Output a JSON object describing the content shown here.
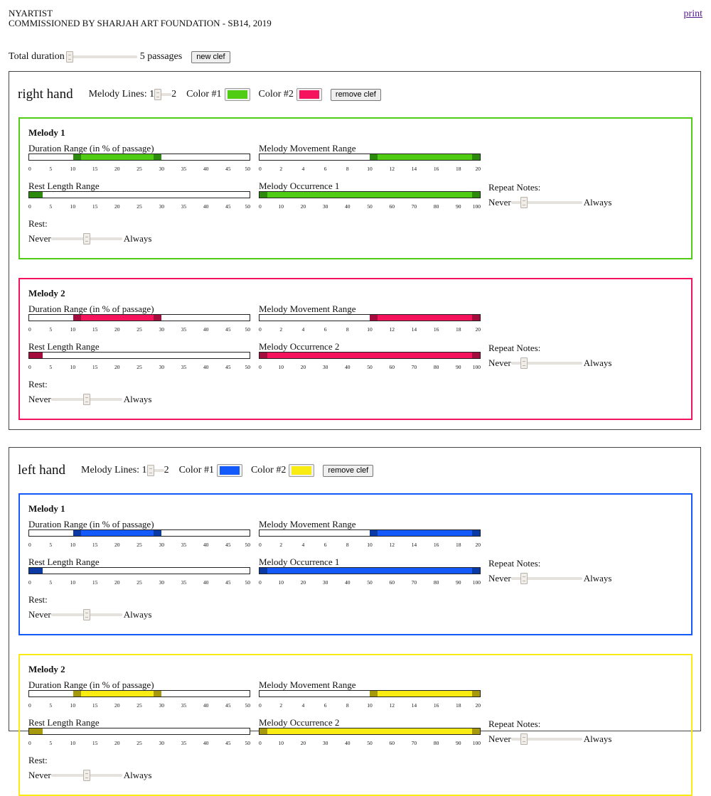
{
  "header": {
    "title": "NYARTIST",
    "subtitle": "COMMISSIONED BY SHARJAH ART FOUNDATION - SB14, 2019",
    "print_link": "print"
  },
  "toolbar": {
    "total_duration_label": "Total duration",
    "total_duration_value": 0,
    "passages_text": "5 passages",
    "new_clef_label": "new clef"
  },
  "labels": {
    "melody_lines": "Melody Lines: 1",
    "melody_lines_max": "2",
    "color1": "Color #1",
    "color2": "Color #2",
    "remove_clef": "remove clef",
    "duration_range": "Duration Range (in % of passage)",
    "movement_range": "Melody Movement Range",
    "rest_length_range": "Rest Length Range",
    "repeat_notes": "Repeat Notes:",
    "rest": "Rest:",
    "never": "Never",
    "always": "Always"
  },
  "clefs": [
    {
      "title": "right hand",
      "melody_lines_value": 1,
      "color1": "#4fcc13",
      "color2": "#f5135e",
      "melodies": [
        {
          "title": "Melody 1",
          "color": "#4fcc13",
          "dark": "#2c8a0c",
          "occurrence_label": "Melody Occurrence 1",
          "duration": [
            10,
            30
          ],
          "movement": [
            10,
            20
          ],
          "rest_length": [
            0,
            3
          ],
          "occurrence": [
            0,
            100
          ],
          "repeat_notes": 0.15,
          "rest": 0.5
        },
        {
          "title": "Melody 2",
          "color": "#f5135e",
          "dark": "#a50c3e",
          "occurrence_label": "Melody Occurrence 2",
          "duration": [
            10,
            30
          ],
          "movement": [
            10,
            20
          ],
          "rest_length": [
            0,
            3
          ],
          "occurrence": [
            0,
            100
          ],
          "repeat_notes": 0.15,
          "rest": 0.5
        }
      ]
    },
    {
      "title": "left hand",
      "melody_lines_value": 1,
      "color1": "#1459fa",
      "color2": "#f8ec12",
      "melodies": [
        {
          "title": "Melody 1",
          "color": "#1459fa",
          "dark": "#0c3aa5",
          "occurrence_label": "Melody Occurrence 1",
          "duration": [
            10,
            30
          ],
          "movement": [
            10,
            20
          ],
          "rest_length": [
            0,
            3
          ],
          "occurrence": [
            0,
            100
          ],
          "repeat_notes": 0.15,
          "rest": 0.5
        },
        {
          "title": "Melody 2",
          "color": "#f8ec12",
          "dark": "#a69a0c",
          "occurrence_label": "Melody Occurrence 2",
          "duration": [
            10,
            30
          ],
          "movement": [
            10,
            20
          ],
          "rest_length": [
            0,
            3
          ],
          "occurrence": [
            0,
            100
          ],
          "repeat_notes": 0.15,
          "rest": 0.5
        }
      ]
    }
  ],
  "scales": {
    "duration": {
      "min": 0,
      "max": 50,
      "ticks": [
        "0",
        "5",
        "10",
        "15",
        "20",
        "25",
        "30",
        "35",
        "40",
        "45",
        "50"
      ]
    },
    "movement": {
      "min": 0,
      "max": 20,
      "ticks": [
        "0",
        "2",
        "4",
        "6",
        "8",
        "10",
        "12",
        "14",
        "16",
        "18",
        "20"
      ]
    },
    "occurrence": {
      "min": 0,
      "max": 100,
      "ticks": [
        "0",
        "10",
        "20",
        "30",
        "40",
        "50",
        "60",
        "70",
        "80",
        "90",
        "100"
      ]
    }
  }
}
